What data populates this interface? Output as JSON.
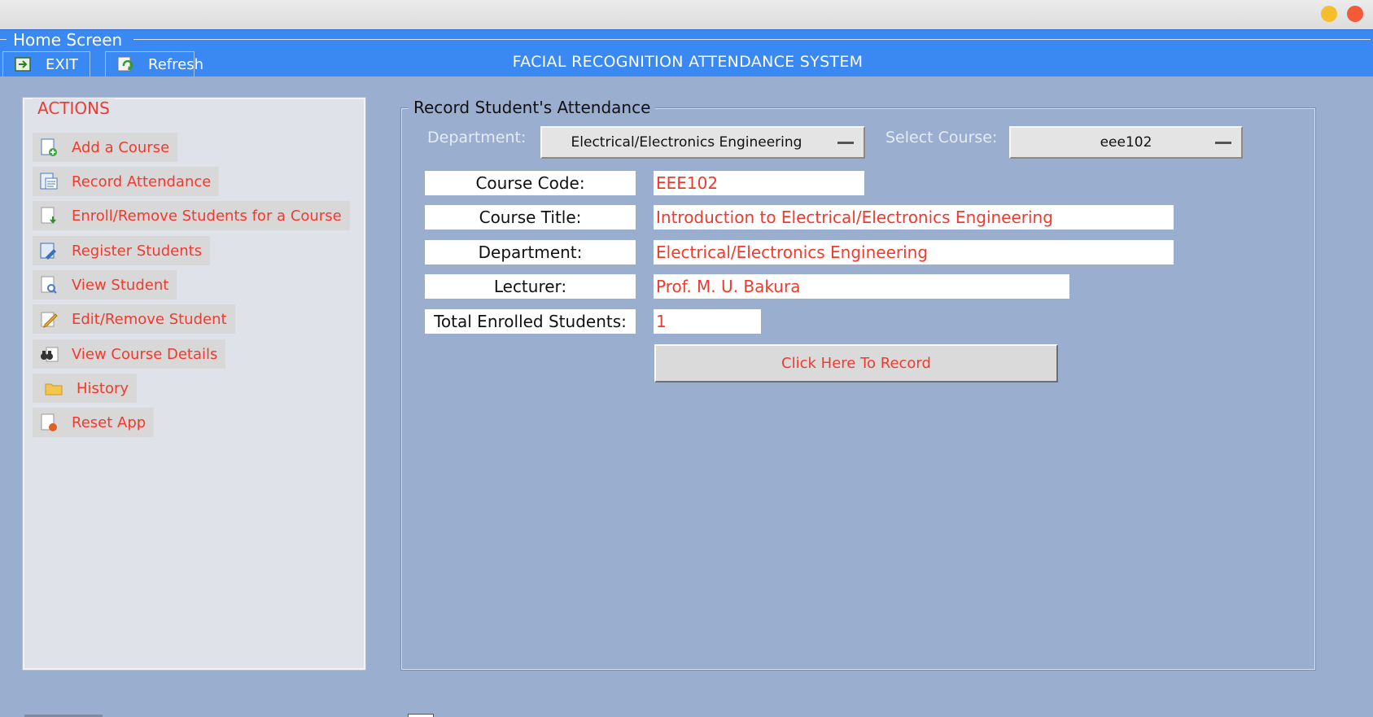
{
  "window": {
    "home_title": "Home Screen",
    "app_title": "FACIAL RECOGNITION ATTENDANCE SYSTEM",
    "exit_label": "EXIT",
    "refresh_label": "Refresh"
  },
  "actions": {
    "legend": "ACTIONS",
    "items": [
      {
        "label": "Add a Course",
        "icon": "add-course-icon"
      },
      {
        "label": "Record Attendance",
        "icon": "record-attendance-icon"
      },
      {
        "label": "Enroll/Remove Students for a Course",
        "icon": "enroll-icon"
      },
      {
        "label": "Register Students",
        "icon": "register-icon"
      },
      {
        "label": "View Student",
        "icon": "view-student-icon"
      },
      {
        "label": "Edit/Remove Student",
        "icon": "edit-icon"
      },
      {
        "label": "View Course Details",
        "icon": "binoculars-icon"
      },
      {
        "label": "History",
        "icon": "folder-icon"
      },
      {
        "label": "Reset App",
        "icon": "reset-icon"
      }
    ]
  },
  "record": {
    "legend": "Record Student's Attendance",
    "department_label": "Department:",
    "department_value": "Electrical/Electronics Engineering",
    "course_label": "Select Course:",
    "course_value": "eee102",
    "fields": [
      {
        "label": "Course Code:",
        "value": "EEE102"
      },
      {
        "label": "Course Title:",
        "value": "Introduction to Electrical/Electronics Engineering"
      },
      {
        "label": "Department:",
        "value": "Electrical/Electronics Engineering"
      },
      {
        "label": "Lecturer:",
        "value": "Prof. M. U. Bakura"
      },
      {
        "label": "Total Enrolled Students:",
        "value": "1"
      }
    ],
    "button_label": "Click Here To Record"
  },
  "colors": {
    "accent_blue": "#3a88f2",
    "main_bg": "#9aaed0",
    "action_text": "#f03a2e",
    "value_text": "#f03a2e"
  }
}
